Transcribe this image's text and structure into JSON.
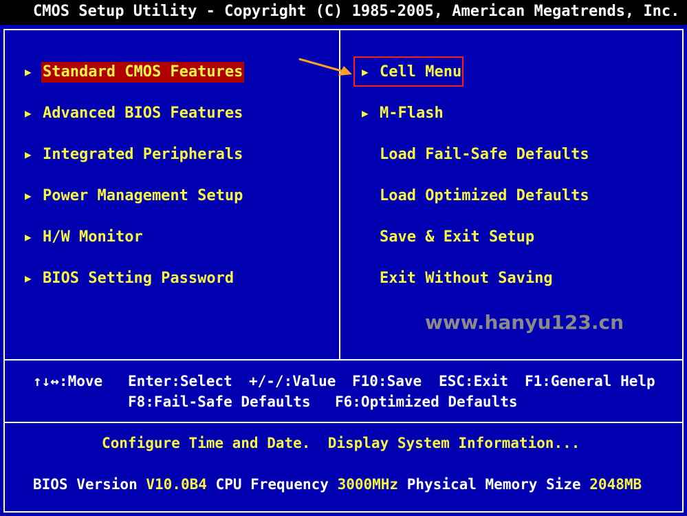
{
  "title_bar": "CMOS Setup Utility - Copyright (C) 1985-2005, American Megatrends, Inc.",
  "left_menu": [
    {
      "label": "Standard CMOS Features",
      "arrow": "▶",
      "selected": true
    },
    {
      "label": "Advanced BIOS Features",
      "arrow": "▶"
    },
    {
      "label": "Integrated Peripherals",
      "arrow": "▶"
    },
    {
      "label": "Power Management Setup",
      "arrow": "▶"
    },
    {
      "label": "H/W Monitor",
      "arrow": "▶"
    },
    {
      "label": "BIOS Setting Password",
      "arrow": "▶"
    }
  ],
  "right_menu": [
    {
      "label": "Cell Menu",
      "arrow": "▶"
    },
    {
      "label": "M-Flash",
      "arrow": "▶"
    },
    {
      "label": "Load Fail-Safe Defaults",
      "arrow": ""
    },
    {
      "label": "Load Optimized Defaults",
      "arrow": ""
    },
    {
      "label": "Save & Exit Setup",
      "arrow": ""
    },
    {
      "label": "Exit Without Saving",
      "arrow": ""
    }
  ],
  "watermark": "www.hanyu123.cn",
  "help": {
    "move": "↑↓↔:Move",
    "select": "Enter:Select",
    "value": "+/-/:Value",
    "save": "F10:Save",
    "exit": "ESC:Exit",
    "general_help": "F1:General Help",
    "fail_safe": "F8:Fail-Safe Defaults",
    "optimized": "F6:Optimized Defaults"
  },
  "description": "Configure Time and Date.  Display System Information...",
  "status": {
    "bios_label": "BIOS Version",
    "bios_value": "V10.0B4",
    "cpu_label": "CPU Frequency",
    "cpu_value": "3000MHz",
    "mem_label": "Physical Memory Size",
    "mem_value": "2048MB"
  },
  "colors": {
    "background": "#0000b0",
    "menu_text": "#f5f542",
    "selected_bg": "#b00000",
    "highlight_box": "#ff1a1a",
    "arrow": "#ffa020"
  }
}
